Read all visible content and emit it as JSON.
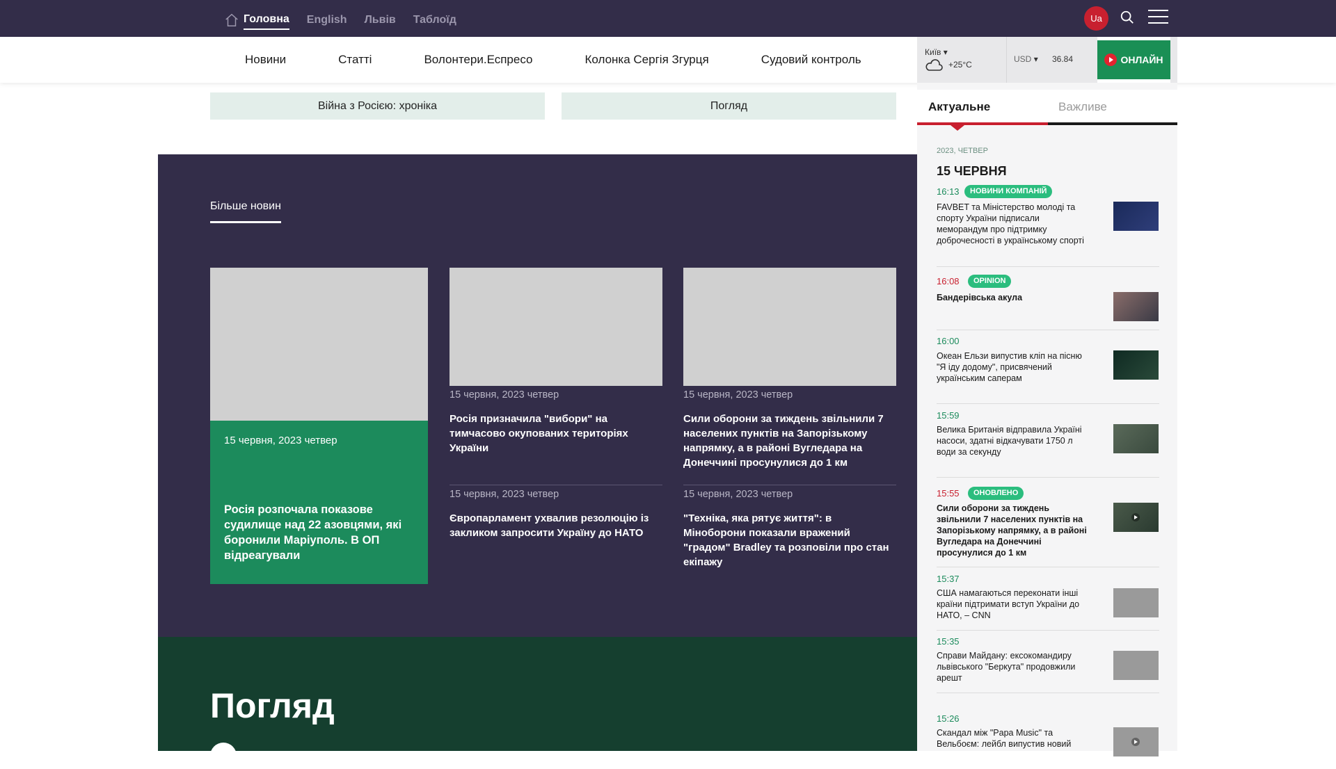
{
  "topnav": {
    "items": [
      "Головна",
      "English",
      "Львів",
      "Таблоїд"
    ],
    "lang_badge": "Ua"
  },
  "secnav": {
    "items": [
      "Новини",
      "Статті",
      "Волонтери.Еспресо",
      "Колонка Сергія Згурця",
      "Судовий контроль"
    ]
  },
  "weather": {
    "city": "Київ",
    "temp": "+25°C"
  },
  "currency": {
    "code": "USD",
    "rate": "36.84"
  },
  "online": {
    "label": "ОНЛАЙН"
  },
  "categories": [
    "Війна з Росією: хроніка",
    "Погляд"
  ],
  "more_news": {
    "heading": "Більше новин",
    "featured": {
      "date": "15 червня, 2023 четвер",
      "title": "Росія розпочала показове судилище над 22 азовцями, які боронили Маріуполь. В ОП відреагували"
    },
    "articles": [
      {
        "date": "15 червня, 2023 четвер",
        "title": "Росія призначила \"вибори\" на тимчасово окупованих територіях України"
      },
      {
        "date": "15 червня, 2023 четвер",
        "title": "Сили оборони за тиждень звільнили 7 населених пунктів на Запорізькому напрямку, а в районі Вугледара на Донеччині просунулися до 1 км"
      },
      {
        "date": "15 червня, 2023 четвер",
        "title": "Європарламент ухвалив резолюцію із закликом запросити Україну до НАТО"
      },
      {
        "date": "15 червня, 2023 четвер",
        "title": "\"Техніка, яка рятує життя\": в Міноборони показали вражений \"градом\" Bradley та розповіли про стан екіпажу"
      }
    ]
  },
  "pohliad": {
    "heading": "Погляд"
  },
  "sidebar": {
    "tabs": [
      "Актуальне",
      "Важливе"
    ],
    "year_label": "2023, ЧЕТВЕР",
    "day_label": "15 ЧЕРВНЯ",
    "items": [
      {
        "time": "16:13",
        "badge": "НОВИНИ КОМПАНІЙ",
        "text": "FAVBET та Міністерство молоді та спорту України підписали меморандум про підтримку доброчесності в українському спорті"
      },
      {
        "time": "16:08",
        "badge": "OPINION",
        "text": "Бандерівська акула"
      },
      {
        "time": "16:00",
        "badge": "",
        "text": "Океан Ельзи випустив кліп на пісню \"Я іду додому\", присвячений українським саперам"
      },
      {
        "time": "15:59",
        "badge": "",
        "text": "Велика Британія відправила Україні насоси, здатні відкачувати 1750 л води за секунду"
      },
      {
        "time": "15:55",
        "badge": "ОНОВЛЕНО",
        "text": "Сили оборони за тиждень звільнили 7 населених пунктів на Запорізькому напрямку, а в районі Вугледара на Донеччині просунулися до 1 км"
      },
      {
        "time": "15:37",
        "badge": "",
        "text": "США намагаються переконати інші країни підтримати вступ України до НАТО, – CNN"
      },
      {
        "time": "15:35",
        "badge": "",
        "text": "Справи Майдану: ексокомандиру львівського \"Беркута\" продовжили арешт"
      },
      {
        "time": "15:26",
        "badge": "",
        "text": "Скандал між \"Papa Music\" та Вельбоєм: лейбл випустив новий"
      }
    ]
  },
  "colors": {
    "dark_purple": "#332d49",
    "brand_green": "#1c8b5c",
    "accent_red": "#c8202f",
    "badge_green": "#2bbd7e"
  }
}
